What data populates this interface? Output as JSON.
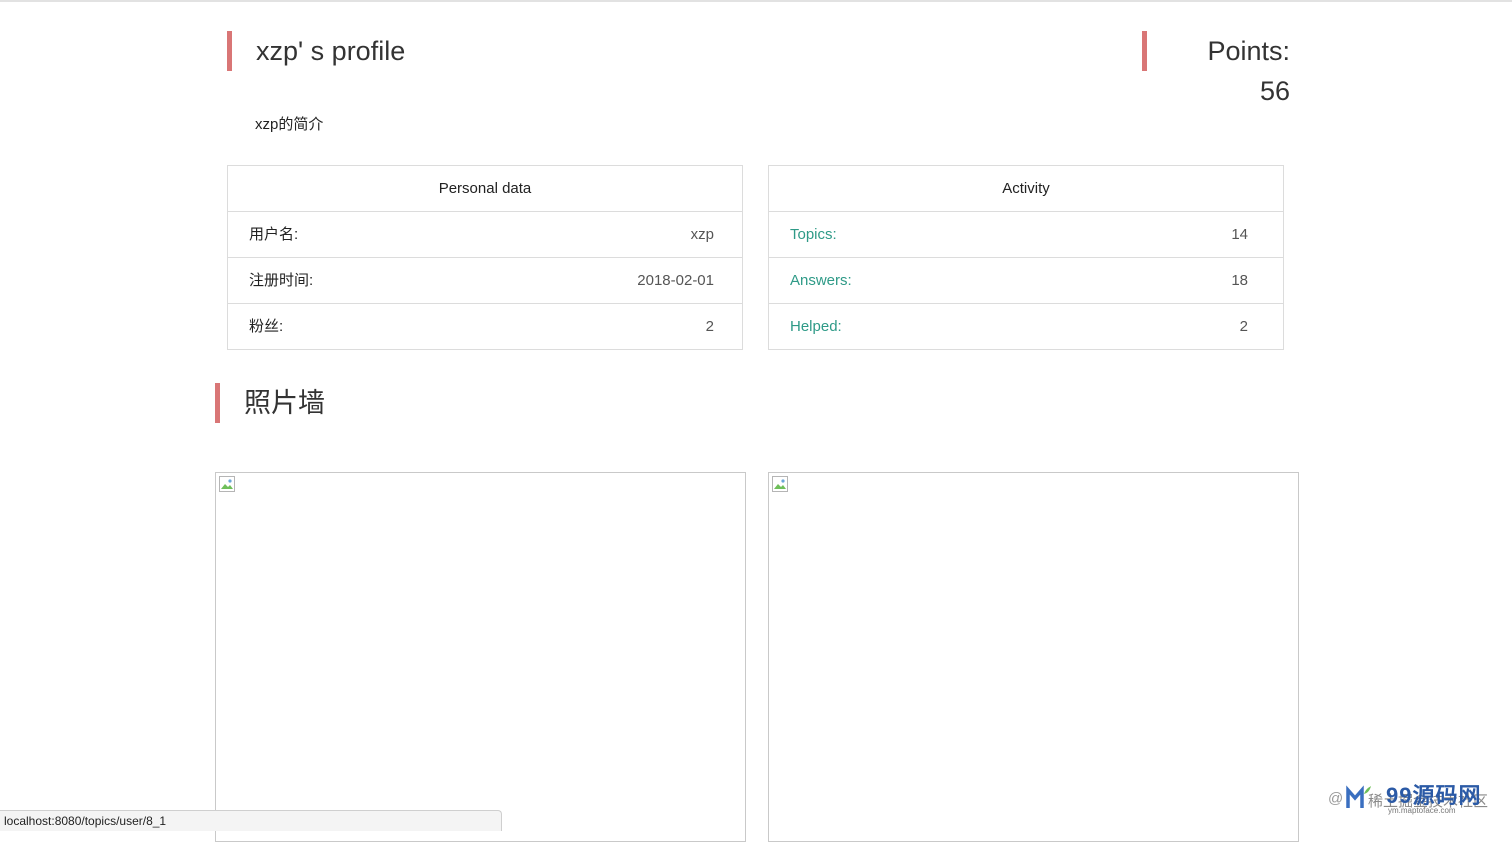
{
  "profile": {
    "title": "xzp' s profile",
    "points": "Points: 56",
    "bio": "xzp的简介"
  },
  "personal_data": {
    "header": "Personal data",
    "rows": [
      {
        "label": "用户名:",
        "value": "xzp"
      },
      {
        "label": "注册时间:",
        "value": "2018-02-01"
      },
      {
        "label": "粉丝:",
        "value": "2"
      }
    ]
  },
  "activity": {
    "header": "Activity",
    "rows": [
      {
        "label": "Topics:",
        "value": "14"
      },
      {
        "label": "Answers:",
        "value": "18"
      },
      {
        "label": "Helped:",
        "value": "2"
      }
    ]
  },
  "photo_wall": {
    "title": "照片墙"
  },
  "status_bar": {
    "url": "localhost:8080/topics/user/8_1"
  },
  "watermark": {
    "at": "@",
    "logo": "99源码网",
    "sub": "稀土掘金技术社区",
    "domain": "ym.maptoface.com"
  },
  "colors": {
    "accent_bar": "#d97676",
    "activity_label": "#2e9a87",
    "border": "#dcdcdc"
  }
}
